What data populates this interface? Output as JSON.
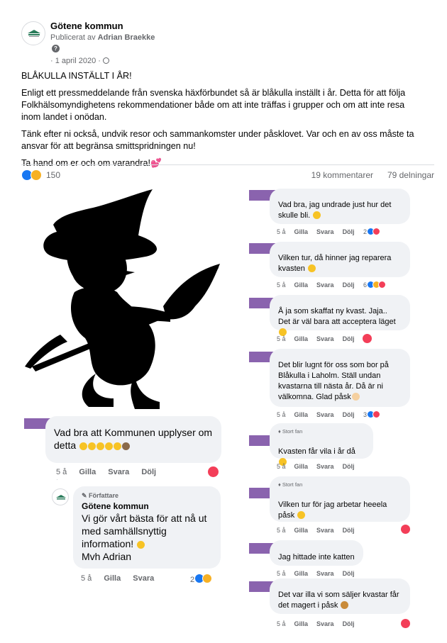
{
  "post": {
    "page_name": "Götene kommun",
    "published_by_prefix": "Publicerat av ",
    "published_by_name": "Adrian Braekke",
    "date": "· 1 april 2020 ·",
    "paragraphs": [
      "BLÅKULLA INSTÄLLT I ÅR!",
      "Enligt ett pressmeddelande från svenska häxförbundet så är blåkulla inställt i år. Detta för att följa Folkhälsomyndighetens rekommendationer både om att inte träffas i grupper och om att inte resa inom landet i onödan.",
      "Tänk efter ni också, undvik resor och sammankomster under påsklovet. Var och en av oss måste ta ansvar för att begränsa smittspridningen nu!",
      "Ta hand om er och om varandra!"
    ],
    "closing_heart": "💕",
    "reaction_count": "150",
    "comments_count": "19 kommentarer",
    "shares_count": "79 delningar"
  },
  "left_comments": {
    "main": {
      "text": "Vad bra att Kommunen upplyser om detta",
      "age": "5 å",
      "like": "Gilla",
      "reply": "Svara",
      "hide": "Dölj"
    },
    "reply": {
      "badge": "Författare",
      "name": "Götene kommun",
      "lines": [
        "Vi gör vårt bästa för att nå ut",
        "med samhällsnyttig",
        "information!"
      ],
      "signoff": "Mvh Adrian",
      "age": "5 å",
      "like": "Gilla",
      "reply_label": "Svara",
      "react_count": "2"
    }
  },
  "right_comments": [
    {
      "text": "Vad bra, jag undrade just hur det skulle bli.",
      "age": "5 å",
      "like": "Gilla",
      "reply": "Svara",
      "hide": "Dölj",
      "react_count": "2"
    },
    {
      "text": "Vilken tur, då hinner jag reparera kvasten",
      "age": "5 å",
      "like": "Gilla",
      "reply": "Svara",
      "hide": "Dölj",
      "react_count": "6"
    },
    {
      "text": "Å ja som skaffat ny kvast. Jaja.. Det är väl bara att acceptera läget",
      "age": "5 å",
      "like": "Gilla",
      "reply": "Svara",
      "hide": "Dölj",
      "react_count": ""
    },
    {
      "text": "Det blir lugnt för oss som bor på Blåkulla i Laholm. Ställ undan kvastarna till nästa år. Då är ni välkomna. Glad påsk",
      "age": "5 å",
      "like": "Gilla",
      "reply": "Svara",
      "hide": "Dölj",
      "react_count": "3"
    },
    {
      "badge": "Stort fan",
      "text": "Kvasten får vila i år då",
      "age": "5 å",
      "like": "Gilla",
      "reply": "Svara",
      "hide": "Dölj",
      "react_count": ""
    },
    {
      "badge": "Stort fan",
      "text": "Vilken tur för jag arbetar heeela påsk",
      "age": "5 å",
      "like": "Gilla",
      "reply": "Svara",
      "hide": "Dölj",
      "react_count": ""
    },
    {
      "text": "Jag hittade inte katten",
      "age": "5 å",
      "like": "Gilla",
      "reply": "Svara",
      "hide": "Dölj",
      "react_count": ""
    },
    {
      "text": "Det var illa vi som säljer kvastar får det magert i påsk",
      "age": "5 å",
      "like": "Gilla",
      "reply": "Svara",
      "hide": "Dölj",
      "react_count": ""
    }
  ],
  "colors": {
    "bubble": "#f0f2f5",
    "redaction": "#8a63ae",
    "like_blue": "#1877f2",
    "love_red": "#f33e58"
  }
}
